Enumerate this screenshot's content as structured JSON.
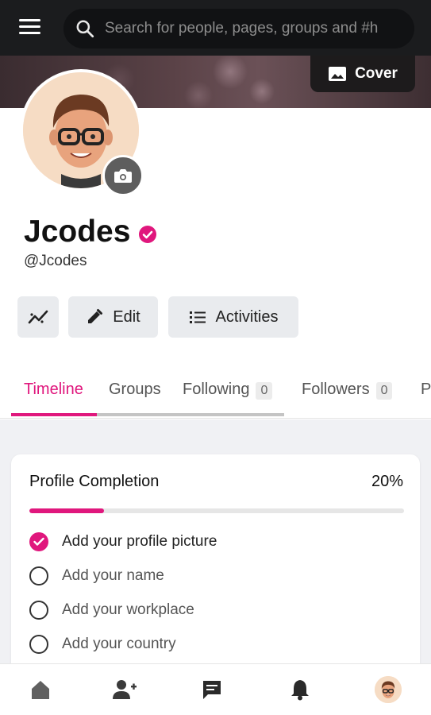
{
  "header": {
    "search_placeholder": "Search for people, pages, groups and #h",
    "menu_icon": "hamburger-menu-icon",
    "search_icon": "search-icon"
  },
  "cover": {
    "button_label": "Cover",
    "button_icon": "image-icon"
  },
  "profile": {
    "name": "Jcodes",
    "handle": "@Jcodes",
    "verified_icon": "verified-check-icon",
    "camera_icon": "camera-icon"
  },
  "actions": {
    "stats_icon": "trending-icon",
    "edit_label": "Edit",
    "activities_label": "Activities"
  },
  "tabs": [
    {
      "label": "Timeline",
      "active": true
    },
    {
      "label": "Groups"
    },
    {
      "label": "Following",
      "count": "0"
    },
    {
      "label": "Followers",
      "count": "0"
    },
    {
      "label": "P"
    }
  ],
  "completion": {
    "title": "Profile Completion",
    "percent_label": "20%",
    "progress": 0.2,
    "tasks": [
      {
        "label": "Add your profile picture",
        "done": true
      },
      {
        "label": "Add your name",
        "done": false
      },
      {
        "label": "Add your workplace",
        "done": false
      },
      {
        "label": "Add your country",
        "done": false
      }
    ]
  },
  "bottom_nav": [
    "home-icon",
    "add-friend-icon",
    "messages-icon",
    "notifications-icon",
    "profile-avatar"
  ],
  "colors": {
    "accent": "#e0177d",
    "topbar": "#1b1c1e",
    "button_bg": "#e9ebee"
  }
}
